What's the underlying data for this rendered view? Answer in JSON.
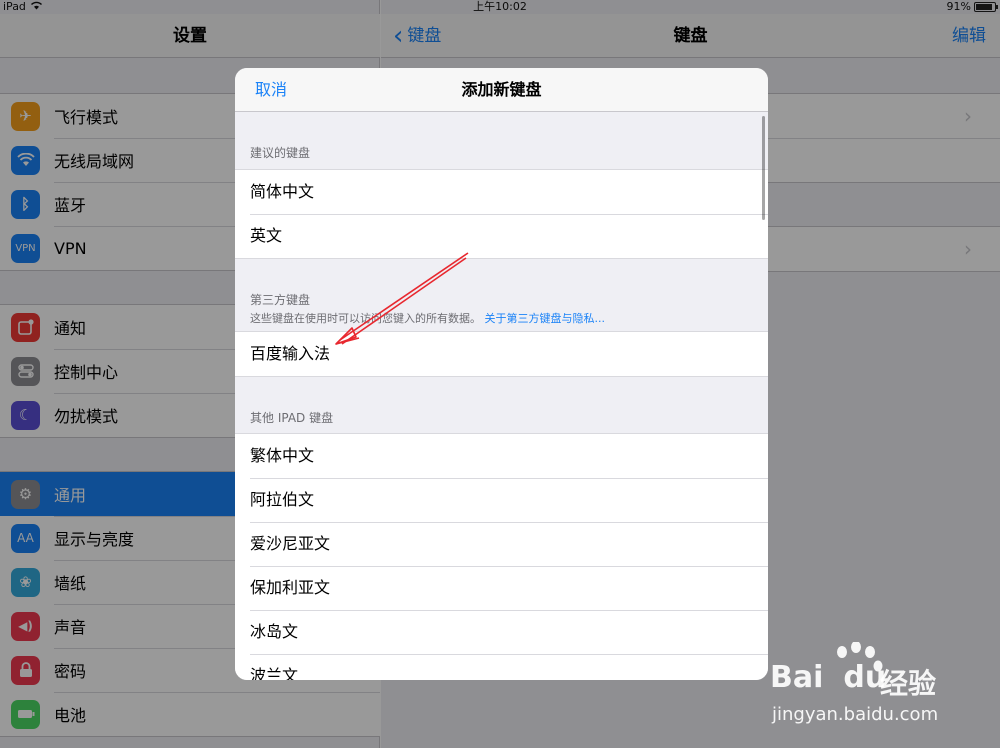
{
  "status_bar": {
    "device": "iPad",
    "time": "上午10:02",
    "battery": "91%",
    "battery_level": 0.91
  },
  "settings": {
    "title": "设置",
    "groups": [
      [
        {
          "label": "飞行模式",
          "icon": "airplane-icon",
          "color": "#f59f1c",
          "glyph": "✈"
        },
        {
          "label": "无线局域网",
          "icon": "wifi-icon",
          "color": "#1a82f7",
          "glyph": "≋"
        },
        {
          "label": "蓝牙",
          "icon": "bluetooth-icon",
          "color": "#1a82f7",
          "glyph": "ᛒ"
        },
        {
          "label": "VPN",
          "icon": "vpn-icon",
          "color": "#1a82f7",
          "glyph": "VPN"
        }
      ],
      [
        {
          "label": "通知",
          "icon": "notifications-icon",
          "color": "#f03a36",
          "glyph": "◧"
        },
        {
          "label": "控制中心",
          "icon": "control-center-icon",
          "color": "#8e8e93",
          "glyph": "⊜"
        },
        {
          "label": "勿扰模式",
          "icon": "do-not-disturb-icon",
          "color": "#5b4fd6",
          "glyph": "☾"
        }
      ],
      [
        {
          "label": "通用",
          "icon": "general-icon",
          "color": "#8e8e93",
          "glyph": "⚙",
          "selected": true
        },
        {
          "label": "显示与亮度",
          "icon": "display-icon",
          "color": "#1a82f7",
          "glyph": "AA"
        },
        {
          "label": "墙纸",
          "icon": "wallpaper-icon",
          "color": "#35aadc",
          "glyph": "❀"
        },
        {
          "label": "声音",
          "icon": "sounds-icon",
          "color": "#f03a50",
          "glyph": "◀)"
        },
        {
          "label": "密码",
          "icon": "passcode-icon",
          "color": "#f03a50",
          "glyph": "⚿"
        },
        {
          "label": "电池",
          "icon": "battery-icon",
          "color": "#4cd964",
          "glyph": "▭"
        }
      ]
    ]
  },
  "keyboards": {
    "back_label": "键盘",
    "title": "键盘",
    "edit_label": "编辑"
  },
  "modal": {
    "cancel_label": "取消",
    "title": "添加新键盘",
    "sections": [
      {
        "header": "建议的键盘",
        "items": [
          "简体中文",
          "英文"
        ]
      },
      {
        "header": "第三方键盘",
        "note": "这些键盘在使用时可以访问您键入的所有数据。",
        "note_link": "关于第三方键盘与隐私...",
        "items": [
          "百度输入法"
        ]
      },
      {
        "header": "其他 IPAD 键盘",
        "items": [
          "繁体中文",
          "阿拉伯文",
          "爱沙尼亚文",
          "保加利亚文",
          "冰岛文",
          "波兰文"
        ]
      }
    ]
  },
  "watermark": {
    "brand": "Bai",
    "brand2": "du",
    "cn": "经验",
    "url": "jingyan.baidu.com"
  }
}
